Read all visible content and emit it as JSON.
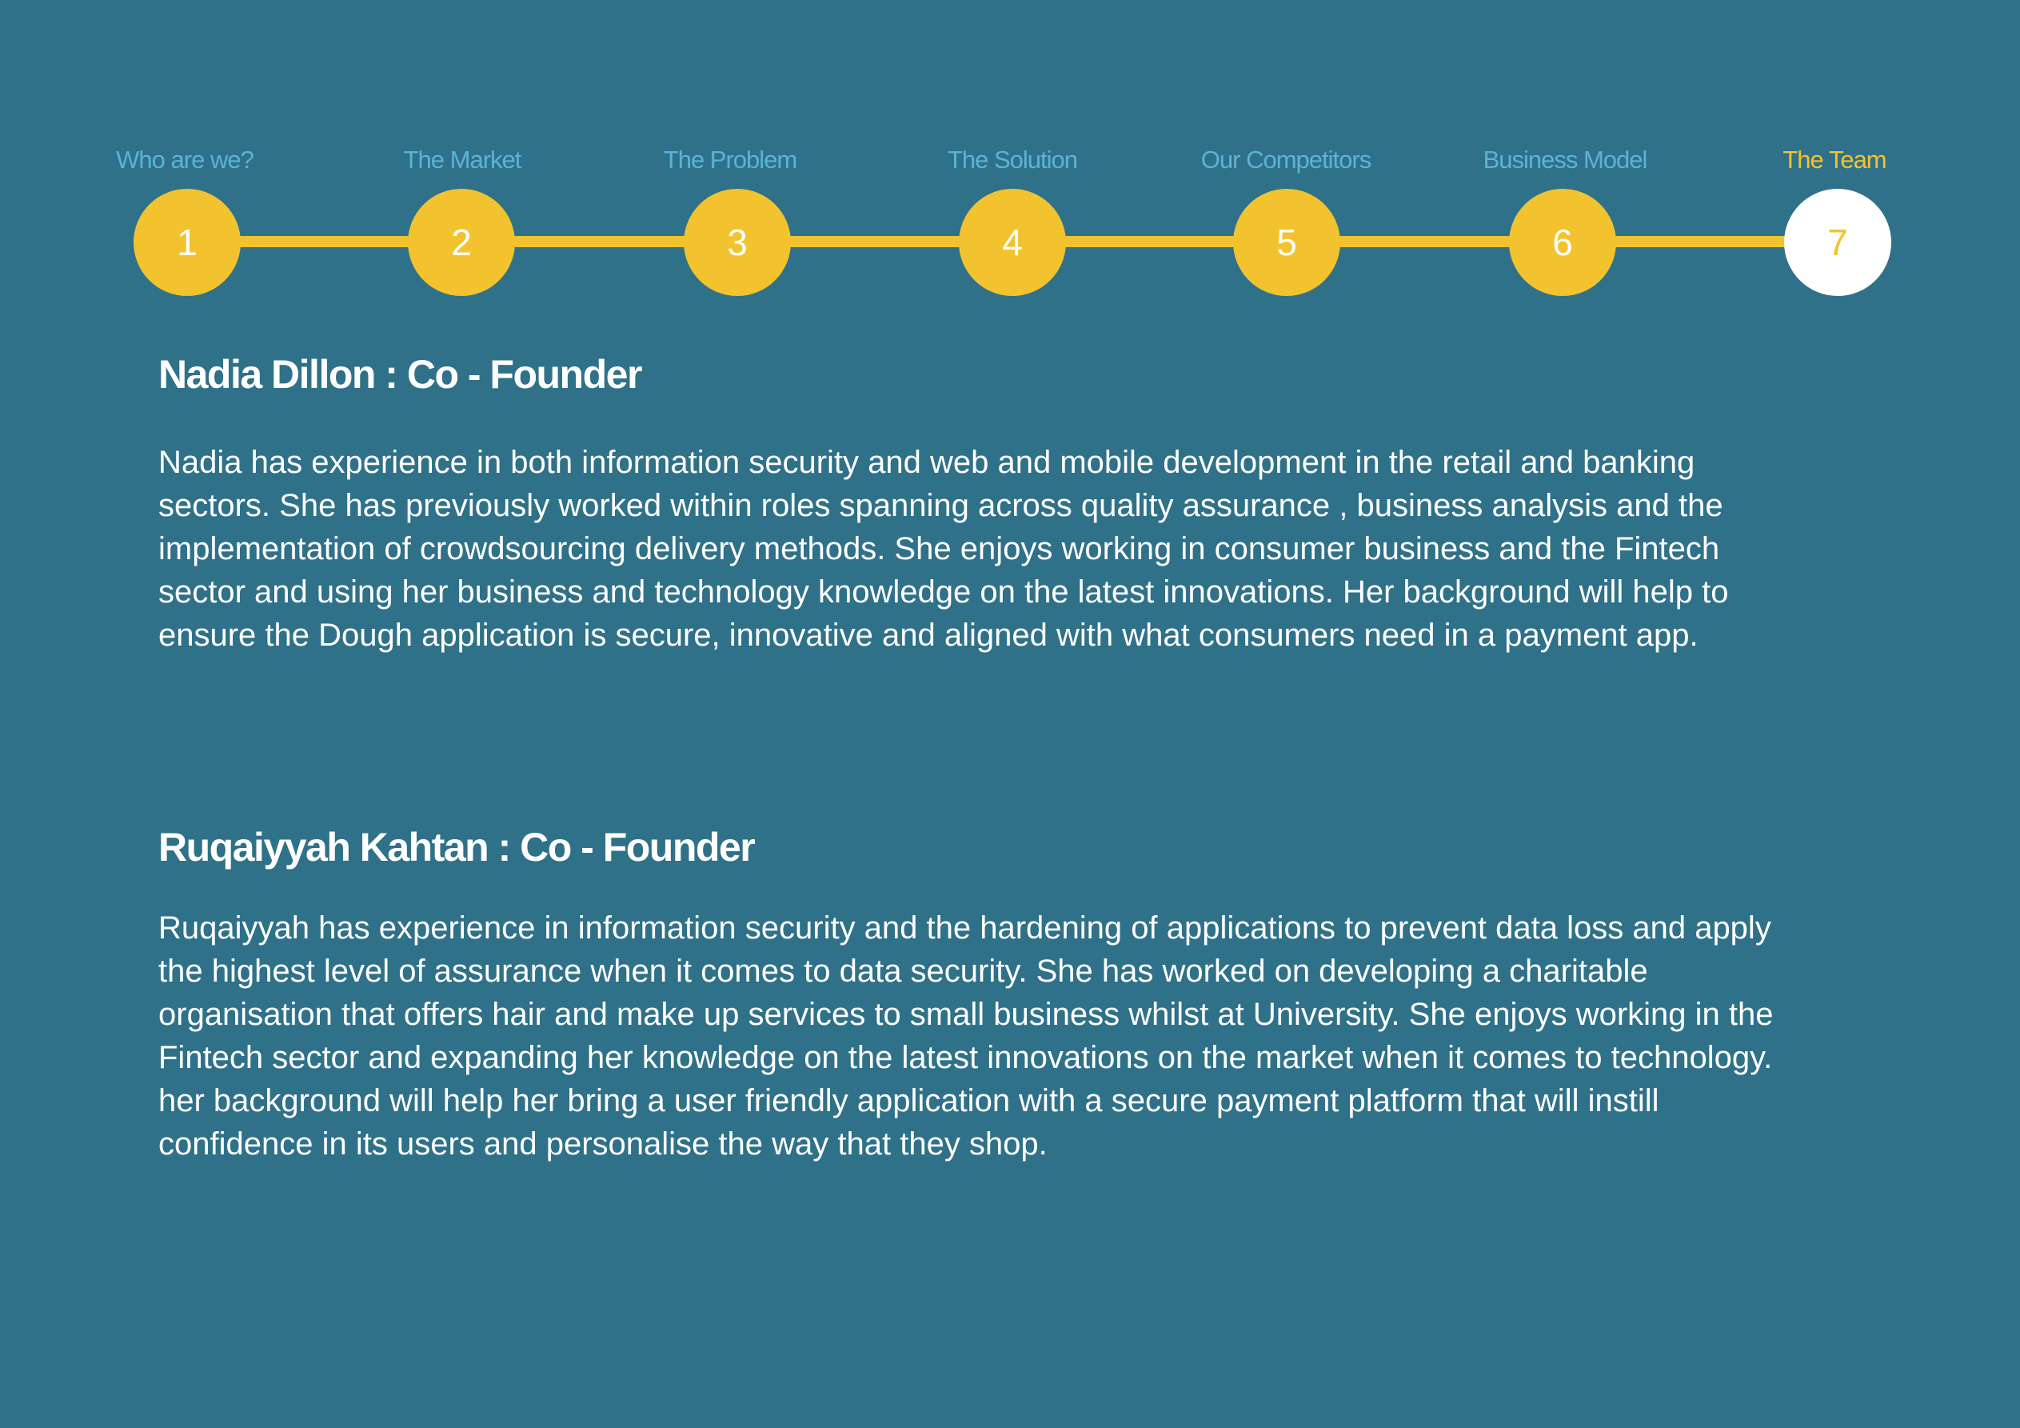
{
  "steps": [
    {
      "label": "Who are we?",
      "number": "1"
    },
    {
      "label": "The Market",
      "number": "2"
    },
    {
      "label": "The Problem",
      "number": "3"
    },
    {
      "label": "The Solution",
      "number": "4"
    },
    {
      "label": "Our Competitors",
      "number": "5"
    },
    {
      "label": "Business Model",
      "number": "6"
    },
    {
      "label": "The Team",
      "number": "7"
    }
  ],
  "active_step": 7,
  "colors": {
    "background": "#2f7188",
    "accent": "#f2c32f",
    "inactive_label": "#5ab4d6",
    "text": "#ffffff"
  },
  "team": [
    {
      "heading": "Nadia Dillon : Co - Founder",
      "bio": "Nadia has experience in both information security and web and mobile development in the retail and banking sectors. She has previously worked within roles spanning  across quality assurance , business analysis and the implementation of crowdsourcing delivery methods. She enjoys working in consumer business and the Fintech sector and using her business and technology knowledge on the latest innovations. Her background will help to ensure the Dough application is secure, innovative and aligned with what consumers need in a payment app."
    },
    {
      "heading": "Ruqaiyyah Kahtan : Co - Founder",
      "bio": "Ruqaiyyah has experience in information security and the hardening of applications to prevent data loss and apply the highest level of assurance when it comes to data security. She has worked on developing a charitable organisation that offers hair and make up services to small business whilst at University. She enjoys working in the Fintech sector and expanding her knowledge on the latest innovations on the market when it comes to technology. her background will help her bring a user friendly application with a secure payment platform that will instill confidence in its users and personalise the way that they shop."
    }
  ]
}
